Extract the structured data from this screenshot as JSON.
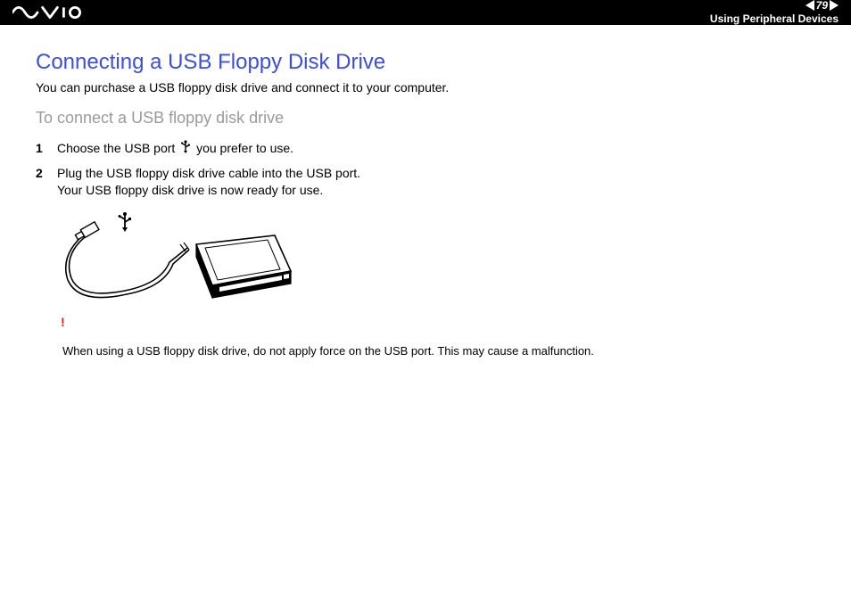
{
  "header": {
    "page_number": "79",
    "section": "Using Peripheral Devices",
    "logo_alt": "VAIO"
  },
  "content": {
    "title": "Connecting a USB Floppy Disk Drive",
    "intro": "You can purchase a USB floppy disk drive and connect it to your computer.",
    "subtitle": "To connect a USB floppy disk drive",
    "steps": [
      {
        "n": "1",
        "before": "Choose the USB port ",
        "after": " you prefer to use."
      },
      {
        "n": "2",
        "before": "Plug the USB floppy disk drive cable into the USB port.",
        "after": "Your USB floppy disk drive is now ready for use."
      }
    ],
    "warning_mark": "!",
    "warning_text": "When using a USB floppy disk drive, do not apply force on the USB port. This may cause a malfunction."
  }
}
